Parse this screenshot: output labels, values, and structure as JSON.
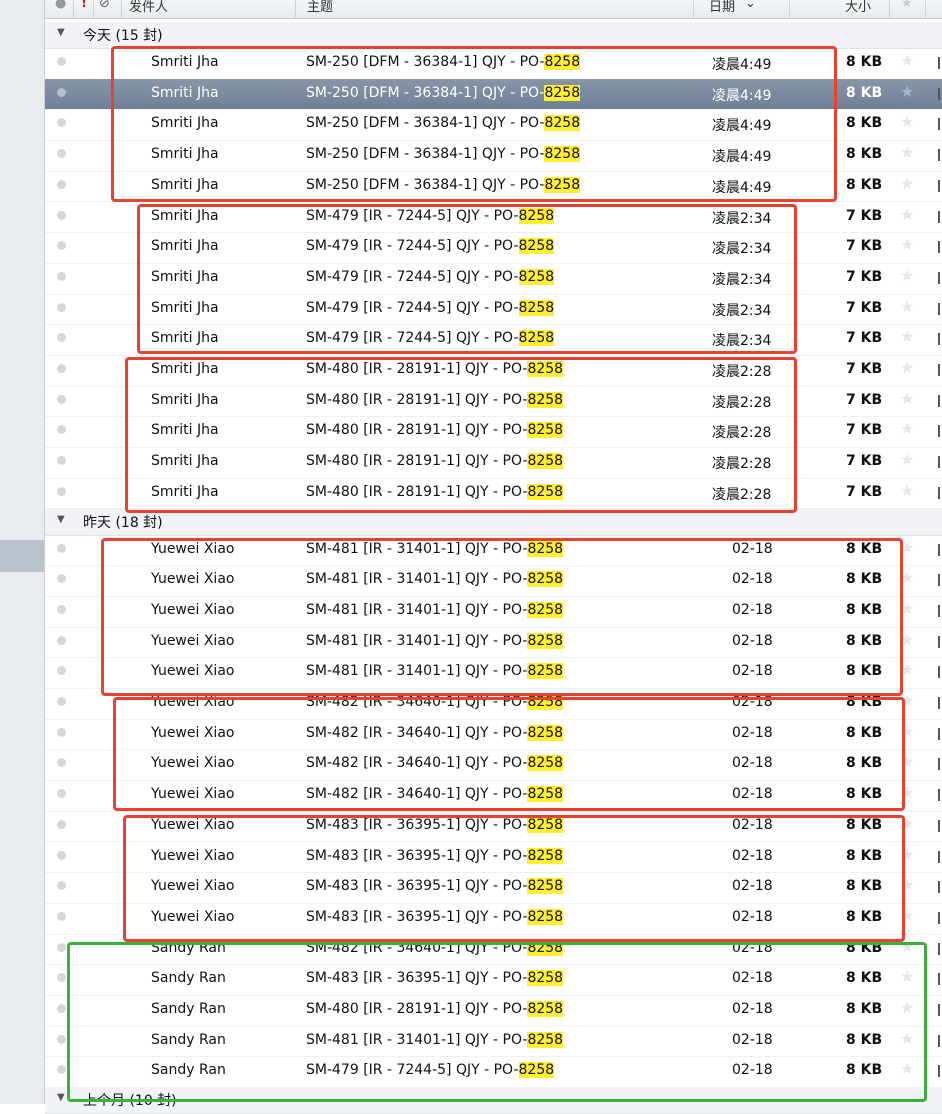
{
  "columns": {
    "flag": "!",
    "from": "发件人",
    "subject": "主题",
    "date": "日期",
    "sort_indicator": "⌄",
    "size": "大小",
    "star": "★"
  },
  "groups": [
    {
      "label": "今天 (15 封)"
    },
    {
      "label": "昨天 (18 封)"
    },
    {
      "label": "上个月 (10 封)"
    }
  ],
  "rows": [
    {
      "from": "Smriti Jha",
      "subject_prefix": "SM-250 [DFM - 36384-1] QJY - PO-",
      "highlight": "8258",
      "date": "凌晨4:49",
      "size": "8 KB"
    },
    {
      "from": "Smriti Jha",
      "subject_prefix": "SM-250 [DFM - 36384-1] QJY - PO-",
      "highlight": "8258",
      "date": "凌晨4:49",
      "size": "8 KB"
    },
    {
      "from": "Smriti Jha",
      "subject_prefix": "SM-250 [DFM - 36384-1] QJY - PO-",
      "highlight": "8258",
      "date": "凌晨4:49",
      "size": "8 KB"
    },
    {
      "from": "Smriti Jha",
      "subject_prefix": "SM-250 [DFM - 36384-1] QJY - PO-",
      "highlight": "8258",
      "date": "凌晨4:49",
      "size": "8 KB"
    },
    {
      "from": "Smriti Jha",
      "subject_prefix": "SM-250 [DFM - 36384-1] QJY - PO-",
      "highlight": "8258",
      "date": "凌晨4:49",
      "size": "8 KB"
    },
    {
      "from": "Smriti Jha",
      "subject_prefix": "SM-479 [IR - 7244-5] QJY - PO-",
      "highlight": "8258",
      "date": "凌晨2:34",
      "size": "7 KB"
    },
    {
      "from": "Smriti Jha",
      "subject_prefix": "SM-479 [IR - 7244-5] QJY - PO-",
      "highlight": "8258",
      "date": "凌晨2:34",
      "size": "7 KB"
    },
    {
      "from": "Smriti Jha",
      "subject_prefix": "SM-479 [IR - 7244-5] QJY - PO-",
      "highlight": "8258",
      "date": "凌晨2:34",
      "size": "7 KB"
    },
    {
      "from": "Smriti Jha",
      "subject_prefix": "SM-479 [IR - 7244-5] QJY - PO-",
      "highlight": "8258",
      "date": "凌晨2:34",
      "size": "7 KB"
    },
    {
      "from": "Smriti Jha",
      "subject_prefix": "SM-479 [IR - 7244-5] QJY - PO-",
      "highlight": "8258",
      "date": "凌晨2:34",
      "size": "7 KB"
    },
    {
      "from": "Smriti Jha",
      "subject_prefix": "SM-480 [IR - 28191-1] QJY - PO-",
      "highlight": "8258",
      "date": "凌晨2:28",
      "size": "7 KB"
    },
    {
      "from": "Smriti Jha",
      "subject_prefix": "SM-480 [IR - 28191-1] QJY - PO-",
      "highlight": "8258",
      "date": "凌晨2:28",
      "size": "7 KB"
    },
    {
      "from": "Smriti Jha",
      "subject_prefix": "SM-480 [IR - 28191-1] QJY - PO-",
      "highlight": "8258",
      "date": "凌晨2:28",
      "size": "7 KB"
    },
    {
      "from": "Smriti Jha",
      "subject_prefix": "SM-480 [IR - 28191-1] QJY - PO-",
      "highlight": "8258",
      "date": "凌晨2:28",
      "size": "7 KB"
    },
    {
      "from": "Smriti Jha",
      "subject_prefix": "SM-480 [IR - 28191-1] QJY - PO-",
      "highlight": "8258",
      "date": "凌晨2:28",
      "size": "7 KB"
    },
    {
      "from": "Yuewei Xiao",
      "subject_prefix": "SM-481 [IR - 31401-1] QJY - PO-",
      "highlight": "8258",
      "date": "02-18",
      "size": "8 KB"
    },
    {
      "from": "Yuewei Xiao",
      "subject_prefix": "SM-481 [IR - 31401-1] QJY - PO-",
      "highlight": "8258",
      "date": "02-18",
      "size": "8 KB"
    },
    {
      "from": "Yuewei Xiao",
      "subject_prefix": "SM-481 [IR - 31401-1] QJY - PO-",
      "highlight": "8258",
      "date": "02-18",
      "size": "8 KB"
    },
    {
      "from": "Yuewei Xiao",
      "subject_prefix": "SM-481 [IR - 31401-1] QJY - PO-",
      "highlight": "8258",
      "date": "02-18",
      "size": "8 KB"
    },
    {
      "from": "Yuewei Xiao",
      "subject_prefix": "SM-481 [IR - 31401-1] QJY - PO-",
      "highlight": "8258",
      "date": "02-18",
      "size": "8 KB"
    },
    {
      "from": "Yuewei Xiao",
      "subject_prefix": "SM-482 [IR - 34640-1] QJY - PO-",
      "highlight": "8258",
      "date": "02-18",
      "size": "8 KB"
    },
    {
      "from": "Yuewei Xiao",
      "subject_prefix": "SM-482 [IR - 34640-1] QJY - PO-",
      "highlight": "8258",
      "date": "02-18",
      "size": "8 KB"
    },
    {
      "from": "Yuewei Xiao",
      "subject_prefix": "SM-482 [IR - 34640-1] QJY - PO-",
      "highlight": "8258",
      "date": "02-18",
      "size": "8 KB"
    },
    {
      "from": "Yuewei Xiao",
      "subject_prefix": "SM-482 [IR - 34640-1] QJY - PO-",
      "highlight": "8258",
      "date": "02-18",
      "size": "8 KB"
    },
    {
      "from": "Yuewei Xiao",
      "subject_prefix": "SM-483 [IR - 36395-1] QJY - PO-",
      "highlight": "8258",
      "date": "02-18",
      "size": "8 KB"
    },
    {
      "from": "Yuewei Xiao",
      "subject_prefix": "SM-483 [IR - 36395-1] QJY - PO-",
      "highlight": "8258",
      "date": "02-18",
      "size": "8 KB"
    },
    {
      "from": "Yuewei Xiao",
      "subject_prefix": "SM-483 [IR - 36395-1] QJY - PO-",
      "highlight": "8258",
      "date": "02-18",
      "size": "8 KB"
    },
    {
      "from": "Yuewei Xiao",
      "subject_prefix": "SM-483 [IR - 36395-1] QJY - PO-",
      "highlight": "8258",
      "date": "02-18",
      "size": "8 KB"
    },
    {
      "from": "Sandy Ran",
      "subject_prefix": "SM-482 [IR - 34640-1] QJY - PO-",
      "highlight": "8258",
      "date": "02-18",
      "size": "8 KB"
    },
    {
      "from": "Sandy Ran",
      "subject_prefix": "SM-483 [IR - 36395-1] QJY - PO-",
      "highlight": "8258",
      "date": "02-18",
      "size": "8 KB"
    },
    {
      "from": "Sandy Ran",
      "subject_prefix": "SM-480 [IR - 28191-1] QJY - PO-",
      "highlight": "8258",
      "date": "02-18",
      "size": "8 KB"
    },
    {
      "from": "Sandy Ran",
      "subject_prefix": "SM-481 [IR - 31401-1] QJY - PO-",
      "highlight": "8258",
      "date": "02-18",
      "size": "8 KB"
    },
    {
      "from": "Sandy Ran",
      "subject_prefix": "SM-479 [IR - 7244-5] QJY - PO-",
      "highlight": "8258",
      "date": "02-18",
      "size": "8 KB"
    }
  ],
  "annotation_colors": {
    "red": "#e8412f",
    "green": "#3cb03c",
    "highlight": "#ffef2e",
    "selected_row": "#7a899e"
  }
}
